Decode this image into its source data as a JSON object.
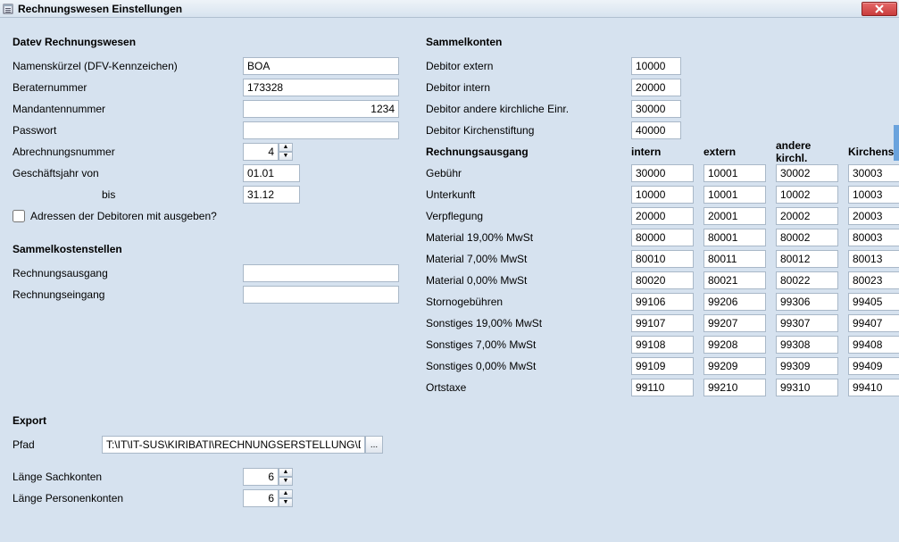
{
  "window": {
    "title": "Rechnungswesen Einstellungen"
  },
  "datev": {
    "header": "Datev Rechnungswesen",
    "namenskuerzel_label": "Namenskürzel (DFV-Kennzeichen)",
    "namenskuerzel_value": "BOA",
    "berater_label": "Beraternummer",
    "berater_value": "173328",
    "mandant_label": "Mandantennummer",
    "mandant_value": "1234",
    "passwort_label": "Passwort",
    "passwort_value": "",
    "abrech_label": "Abrechnungsnummer",
    "abrech_value": "4",
    "gj_von_label": "Geschäftsjahr von",
    "gj_von_value": "01.01",
    "gj_bis_label": "bis",
    "gj_bis_value": "31.12",
    "adressen_check_label": "Adressen der Debitoren mit ausgeben?"
  },
  "kostenstellen": {
    "header": "Sammelkostenstellen",
    "ra_label": "Rechnungsausgang",
    "ra_value": "",
    "re_label": "Rechnungseingang",
    "re_value": ""
  },
  "sammel": {
    "header": "Sammelkonten",
    "deb_extern_label": "Debitor extern",
    "deb_extern_value": "10000",
    "deb_intern_label": "Debitor intern",
    "deb_intern_value": "20000",
    "deb_andere_label": "Debitor andere kirchliche Einr.",
    "deb_andere_value": "30000",
    "deb_stift_label": "Debitor Kirchenstiftung",
    "deb_stift_value": "40000"
  },
  "grid": {
    "header_label": "Rechnungsausgang",
    "cols": [
      "intern",
      "extern",
      "andere kirchl.",
      "Kirchenstiftung"
    ],
    "rows": [
      {
        "label": "Gebühr",
        "v": [
          "30000",
          "10001",
          "30002",
          "30003"
        ]
      },
      {
        "label": "Unterkunft",
        "v": [
          "10000",
          "10001",
          "10002",
          "10003"
        ]
      },
      {
        "label": "Verpflegung",
        "v": [
          "20000",
          "20001",
          "20002",
          "20003"
        ]
      },
      {
        "label": "Material 19,00% MwSt",
        "v": [
          "80000",
          "80001",
          "80002",
          "80003"
        ]
      },
      {
        "label": "Material 7,00% MwSt",
        "v": [
          "80010",
          "80011",
          "80012",
          "80013"
        ]
      },
      {
        "label": "Material 0,00% MwSt",
        "v": [
          "80020",
          "80021",
          "80022",
          "80023"
        ]
      },
      {
        "label": "Stornogebühren",
        "v": [
          "99106",
          "99206",
          "99306",
          "99405"
        ]
      },
      {
        "label": "Sonstiges 19,00% MwSt",
        "v": [
          "99107",
          "99207",
          "99307",
          "99407"
        ]
      },
      {
        "label": "Sonstiges 7,00% MwSt",
        "v": [
          "99108",
          "99208",
          "99308",
          "99408"
        ]
      },
      {
        "label": "Sonstiges 0,00% MwSt",
        "v": [
          "99109",
          "99209",
          "99309",
          "99409"
        ]
      },
      {
        "label": "Ortstaxe",
        "v": [
          "99110",
          "99210",
          "99310",
          "99410"
        ]
      }
    ]
  },
  "export": {
    "header": "Export",
    "pfad_label": "Pfad",
    "pfad_value": "T:\\IT\\IT-SUS\\KIRIBATI\\RECHNUNGSERSTELLUNG\\DATE",
    "browse_label": "...",
    "sach_label": "Länge Sachkonten",
    "sach_value": "6",
    "pers_label": "Länge Personenkonten",
    "pers_value": "6"
  }
}
